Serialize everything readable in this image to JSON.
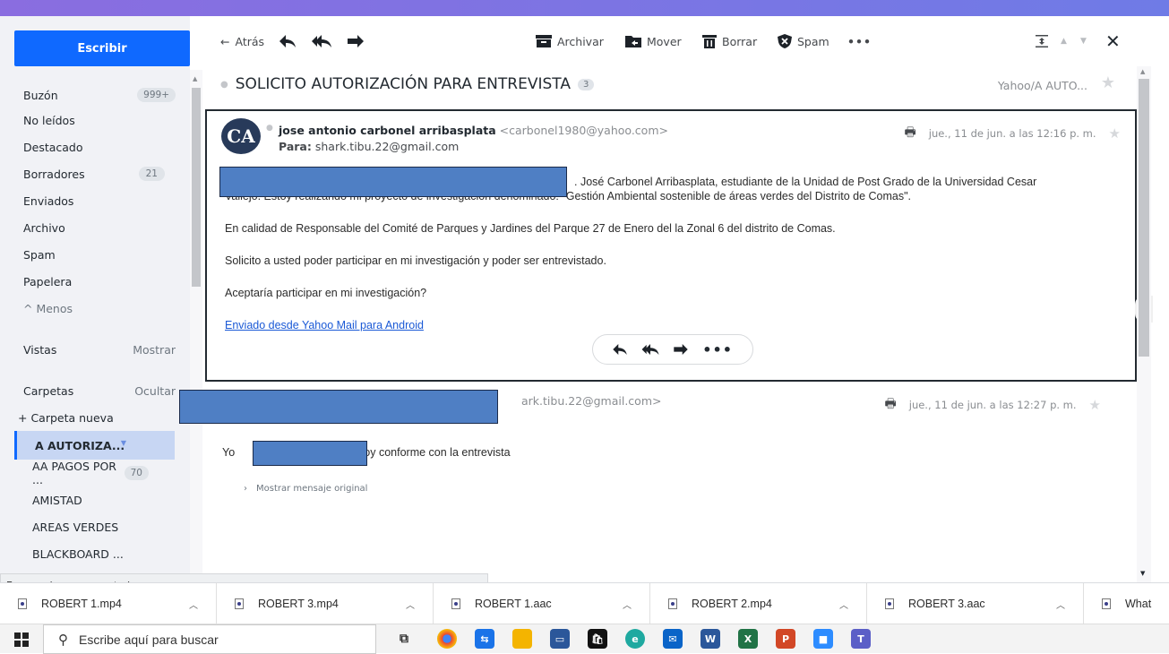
{
  "toolbar": {
    "back": "Atrás",
    "archive": "Archivar",
    "move": "Mover",
    "delete": "Borrar",
    "spam": "Spam",
    "more": "•••"
  },
  "sidebar": {
    "compose": "Escribir",
    "inbox": "Buzón",
    "inbox_count": "999+",
    "unread": "No leídos",
    "starred": "Destacado",
    "drafts": "Borradores",
    "drafts_count": "21",
    "sent": "Enviados",
    "archive": "Archivo",
    "spam": "Spam",
    "trash": "Papelera",
    "less": "^ Menos",
    "views": "Vistas",
    "views_action": "Mostrar",
    "folders": "Carpetas",
    "folders_action": "Ocultar",
    "new_folder": "+ Carpeta nueva",
    "folder_selected": "A AUTORIZA...",
    "folder_pagos": "AA PAGOS POR ...",
    "folder_pagos_count": "70",
    "folder_amistad": "AMISTAD",
    "folder_areas": "AREAS VERDES",
    "folder_blackboard": "BLACKBOARD ..."
  },
  "thread": {
    "subject": "SOLICITO AUTORIZACIÓN PARA ENTREVISTA",
    "count": "3",
    "folder_crumb": "Yahoo/A AUTO..."
  },
  "message1": {
    "avatar": "CA",
    "from_name": "jose antonio carbonel arribasplata",
    "from_email": "<carbonel1980@yahoo.com>",
    "to_label": "Para:",
    "to": "shark.tibu.22@gmail.com",
    "date": "jue., 11 de jun. a las 12:16 p. m.",
    "p1a": ". José Carbonel Arribasplata, estudiante de la Unidad de Post Grado de la Universidad Cesar",
    "p1b": "Vallejo. Estoy realizando mi proyecto de investigación denominado: \"Gestión Ambiental sostenible de áreas verdes del Distrito de Comas\".",
    "p2": "En calidad de Responsable del Comité de Parques y Jardines del Parque 27 de Enero del la Zonal 6 del distrito de Comas.",
    "p3": "Solicito a usted poder participar en mi investigación y poder ser entrevistado.",
    "p4": "Aceptaría participar en mi investigación?",
    "link": "Enviado desde Yahoo Mail para Android"
  },
  "message2": {
    "from_email_tail": "ark.tibu.22@gmail.com>",
    "date": "jue., 11 de jun. a las 12:27 p. m.",
    "body_start": "Yo",
    "body_end": "si estoy conforme con la entrevista",
    "show_original": "Mostrar mensaje original"
  },
  "status": "Esperando a apx.moatads.com...",
  "downloads": [
    "ROBERT 1.mp4",
    "ROBERT 3.mp4",
    "ROBERT 1.aac",
    "ROBERT 2.mp4",
    "ROBERT 3.aac",
    "What"
  ],
  "taskbar": {
    "search_placeholder": "Escribe aquí para buscar"
  },
  "colors": {
    "accent": "#0f69ff",
    "topbar": "#7a6fe3",
    "redaction": "#4f7fc4"
  }
}
